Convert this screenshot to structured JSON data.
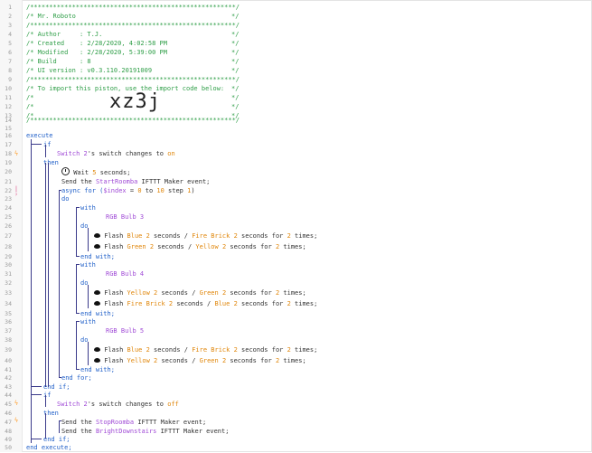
{
  "line_numbers": [
    "1",
    "2",
    "3",
    "4",
    "5",
    "6",
    "7",
    "8",
    "9",
    "10",
    "11",
    "12",
    "13",
    "14",
    "15",
    "16",
    "17",
    "18",
    "19",
    "20",
    "21",
    "22",
    "23",
    "24",
    "25",
    "26",
    "27",
    "28",
    "29",
    "30",
    "31",
    "32",
    "33",
    "34",
    "35",
    "36",
    "37",
    "38",
    "39",
    "40",
    "41",
    "42",
    "43",
    "44",
    "45",
    "46",
    "47",
    "48",
    "49",
    "50"
  ],
  "header": {
    "stars": "/******************************************************/",
    "name_label": "/* Mr. Roboto",
    "name_end": "*/",
    "author_label": "/* Author     : T.J.",
    "author_end": "*/",
    "created_label": "/* Created    : 2/28/2020, 4:02:58 PM",
    "created_end": "*/",
    "modified_label": "/* Modified   : 2/28/2020, 5:39:00 PM",
    "modified_end": "*/",
    "build_label": "/* Build      : 8",
    "build_end": "*/",
    "ui_label": "/* UI version : v0.3.110.20191009",
    "ui_end": "*/",
    "import_label": "/* To import this piston, use the import code below:",
    "import_end": "*/",
    "blank_start": "/*",
    "blank_end": "*/",
    "import_code": "xz3j"
  },
  "code": {
    "execute": "execute",
    "if": "if",
    "then": "then",
    "do": "do",
    "with": "with",
    "end_if": "end if;",
    "end_with": "end with;",
    "end_for": "end for;",
    "end_execute": "end execute;",
    "switch_2": "Switch 2",
    "switch_changes_to": "'s switch changes to",
    "on": "on",
    "off": "off",
    "wait": "Wait",
    "wait_val": "5",
    "wait_unit": "seconds;",
    "send_the": "Send the",
    "ifttt": "IFTTT Maker event;",
    "start_roomba": "StartRoomba",
    "stop_roomba": "StopRoomba",
    "bright_downstairs": "BrightDownstairs",
    "async_for": "async for (",
    "index": "$index",
    "eq": " = ",
    "zero": "0",
    "to": " to ",
    "ten": "10",
    "step": " step ",
    "one": "1",
    "close_paren": ")",
    "rgb3": "RGB Bulb 3",
    "rgb4": "RGB Bulb 4",
    "rgb5": "RGB Bulb 5",
    "flash": "Flash",
    "two": "2",
    "seconds": "seconds",
    "slash": " / ",
    "for_word": "seconds for",
    "times": "times;",
    "blue": "Blue",
    "fire_brick": "Fire Brick",
    "green": "Green",
    "yellow": "Yellow"
  },
  "colors": {
    "comment": "#2e9e47",
    "keyword": "#1f5fc8",
    "device": "#a04bd6",
    "value": "#e0860a",
    "marker": "#ff9f2e"
  },
  "markers": {
    "trigger_icon": "lightning-icon",
    "async_icon": "async-icon",
    "wait_icon": "clock-icon",
    "bulb_icon": "bulb-icon"
  }
}
